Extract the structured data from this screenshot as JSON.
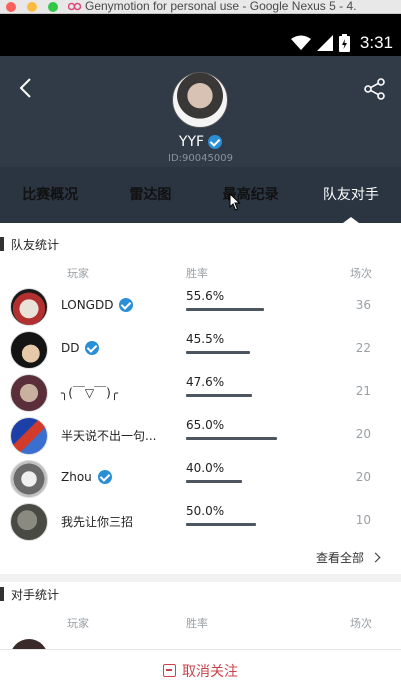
{
  "window": {
    "title": "Genymotion for personal use - Google Nexus 5 - 4."
  },
  "statusbar": {
    "time": "3:31",
    "icons": [
      "wifi-icon",
      "signal-icon",
      "battery-icon"
    ]
  },
  "header": {
    "username": "YYF",
    "user_id": "ID:90045009",
    "verified": true
  },
  "tabs": [
    {
      "label": "比赛概况",
      "active": false
    },
    {
      "label": "雷达图",
      "active": false
    },
    {
      "label": "最高纪录",
      "active": false
    },
    {
      "label": "队友对手",
      "active": true
    }
  ],
  "teammates": {
    "title": "队友统计",
    "columns": {
      "player": "玩家",
      "winrate": "胜率",
      "games": "场次"
    },
    "rows": [
      {
        "name": "LONGDD",
        "verified": true,
        "rate": "55.6%",
        "rate_value": 55.6,
        "games": "36"
      },
      {
        "name": "DD",
        "verified": true,
        "rate": "45.5%",
        "rate_value": 45.5,
        "games": "22"
      },
      {
        "name": "╮(￣▽￣)╭",
        "verified": false,
        "rate": "47.6%",
        "rate_value": 47.6,
        "games": "21"
      },
      {
        "name": "半天说不出一句...",
        "verified": false,
        "rate": "65.0%",
        "rate_value": 65.0,
        "games": "20"
      },
      {
        "name": "Zhou",
        "verified": true,
        "rate": "40.0%",
        "rate_value": 40.0,
        "games": "20"
      },
      {
        "name": "我先让你三招",
        "verified": false,
        "rate": "50.0%",
        "rate_value": 50.0,
        "games": "10"
      }
    ],
    "see_all": "查看全部"
  },
  "opponents": {
    "title": "对手统计",
    "columns": {
      "player": "玩家",
      "winrate": "胜率",
      "games": "场次"
    }
  },
  "bottom": {
    "unfollow_label": "取消关注"
  },
  "colors": {
    "header": "#303b47",
    "tabs": "#2b3541",
    "accent": "#2b8fd6",
    "danger": "#c9444a",
    "bar": "#4c5560"
  }
}
